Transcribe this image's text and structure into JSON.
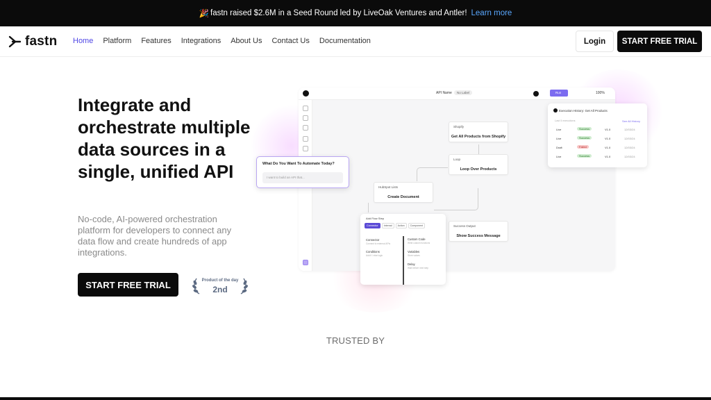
{
  "announcement": {
    "emoji": "🎉",
    "text": "fastn raised $2.6M in a Seed Round led by LiveOak Ventures and Antler!",
    "link": "Learn more"
  },
  "nav": {
    "logo_text": "fastn",
    "links": [
      "Home",
      "Platform",
      "Features",
      "Integrations",
      "About Us",
      "Contact Us",
      "Documentation"
    ],
    "active_link": "Home",
    "login": "Login",
    "cta": "START FREE TRIAL"
  },
  "hero": {
    "title": "Integrate and orchestrate multiple data sources in a single, unified API",
    "subtitle": "No-code, AI-powered orchestration platform for developers to connect any data flow and create hundreds of app integrations.",
    "cta": "START FREE TRIAL",
    "badge_label": "Product of the day",
    "badge_rank": "2nd"
  },
  "app_mock": {
    "api_name": "API Name",
    "label": "No Label",
    "run": "Run",
    "zoom": "100%",
    "nodes": [
      {
        "head": "Shopify",
        "title": "Get All Products from Shopify"
      },
      {
        "head": "Loop",
        "title": "Loop Over Products"
      },
      {
        "head": "HubSpot Lists",
        "title": "Create Document"
      },
      {
        "head": "Success Output",
        "title": "Show Success Message"
      }
    ],
    "ask": {
      "question": "What Do You Want To Automate Today?",
      "placeholder": "I want to build an API that..."
    },
    "history": {
      "title": "Execution History: Get All Products",
      "sub": "Last 5 executions",
      "link": "See All History",
      "rows": [
        {
          "env": "Live",
          "status": "Success",
          "ver": "V1.0",
          "date": "12/03/24"
        },
        {
          "env": "Live",
          "status": "Success",
          "ver": "V1.0",
          "date": "12/03/24"
        },
        {
          "env": "Draft",
          "status": "Failed",
          "ver": "V1.0",
          "date": "12/03/24"
        },
        {
          "env": "Live",
          "status": "Success",
          "ver": "V1.0",
          "date": "12/03/24"
        }
      ]
    },
    "flow": {
      "head": "Add Flow Step",
      "tabs": [
        "Connector",
        "Internal",
        "Action",
        "Component"
      ],
      "left_items": [
        {
          "t": "Connector",
          "s": "Connect to external APIs"
        },
        {
          "t": "Conditions",
          "s": "Add if / else logic"
        }
      ],
      "right_items": [
        {
          "t": "Custom Code",
          "s": "Write custom functions"
        },
        {
          "t": "Variables",
          "s": "Store values"
        },
        {
          "t": "Delay",
          "s": "Wait before next step"
        }
      ]
    }
  },
  "trusted_by": "TRUSTED BY",
  "colors": {
    "accent": "#4f46e5",
    "dark": "#0b0b0b",
    "purple": "#7c6cf0"
  }
}
